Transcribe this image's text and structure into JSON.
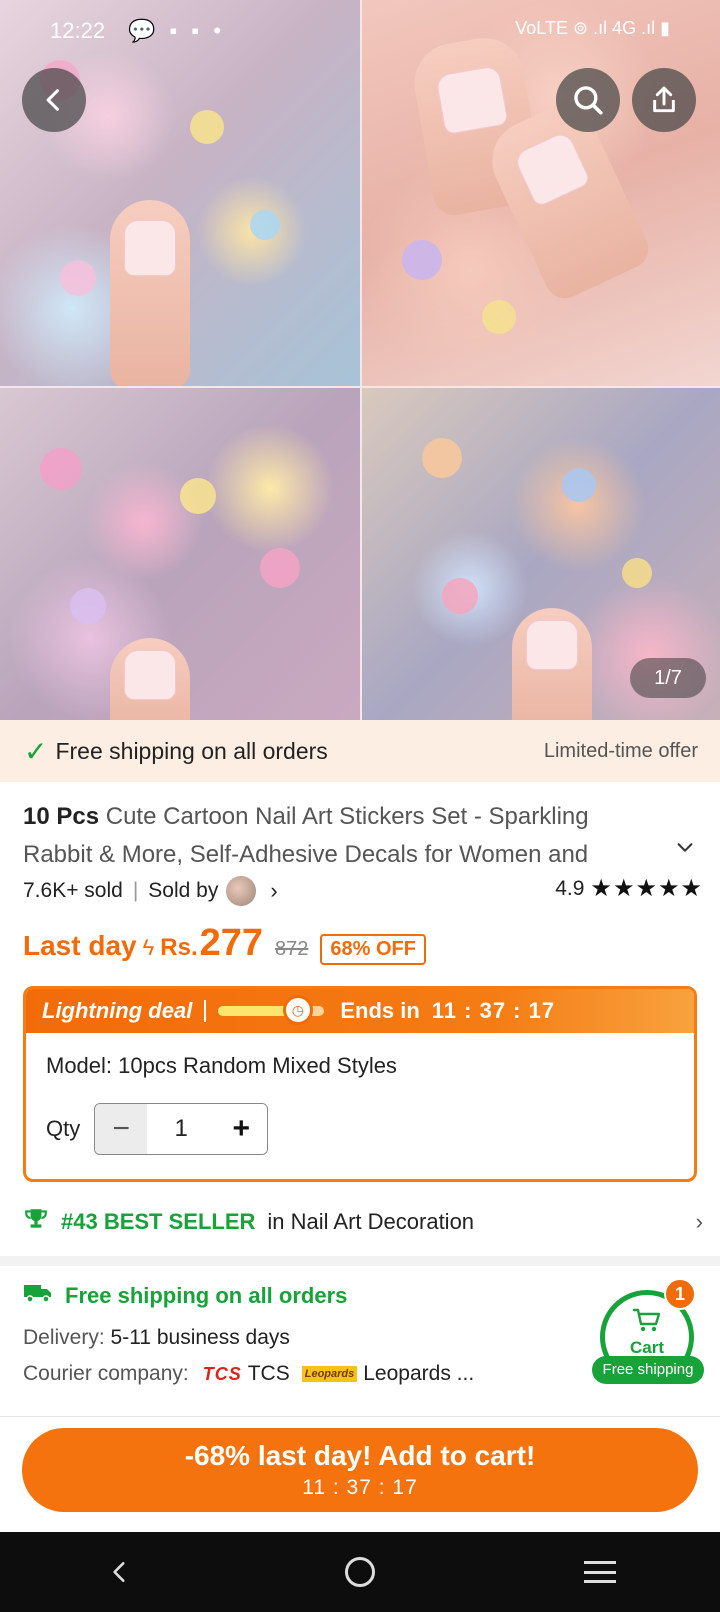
{
  "status_bar": {
    "time": "12:22",
    "left_icons": "💬 ▪ ▪ •",
    "right_icons": "VoLTE ⊚ .ıl 4G .ıl ▮"
  },
  "gallery": {
    "counter": "1/7"
  },
  "shipping_banner": {
    "text": "Free shipping on all orders",
    "offer": "Limited-time offer"
  },
  "product": {
    "title_bold": "10 Pcs",
    "title_rest": " Cute Cartoon Nail Art Stickers Set - Sparkling Rabbit & More, Self-Adhesive Decals for Women and",
    "sold": "7.6K+ sold",
    "sold_by": "Sold by",
    "rating": "4.9",
    "stars": "★★★★★"
  },
  "price": {
    "last_day": "Last day",
    "currency": "Rs.",
    "current": "277",
    "original": "872",
    "discount": "68% OFF"
  },
  "deal": {
    "title": "Lightning deal",
    "progress_fraction": 0.75,
    "ends_label": "Ends in",
    "timer": "11 : 37 : 17",
    "model": "Model: 10pcs Random Mixed Styles",
    "qty_label": "Qty",
    "qty_value": "1"
  },
  "best_seller": {
    "rank": "#43 BEST SELLER",
    "category": "in Nail Art Decoration"
  },
  "shipping": {
    "title": "Free shipping on all orders",
    "delivery_label": "Delivery:",
    "delivery_value": "5-11 business days",
    "courier_label": "Courier company:",
    "tcs_logo": "TCS",
    "tcs_name": "TCS",
    "leopards_logo": "Leopards",
    "leopards_name": "Leopards ..."
  },
  "cart": {
    "label": "Cart",
    "count": "1",
    "free": "Free shipping"
  },
  "add_to_cart": {
    "label": "-68% last day! Add to cart!",
    "timer": "11 : 37 : 17"
  },
  "colors": {
    "accent": "#f5730e",
    "green": "#17a23a"
  }
}
